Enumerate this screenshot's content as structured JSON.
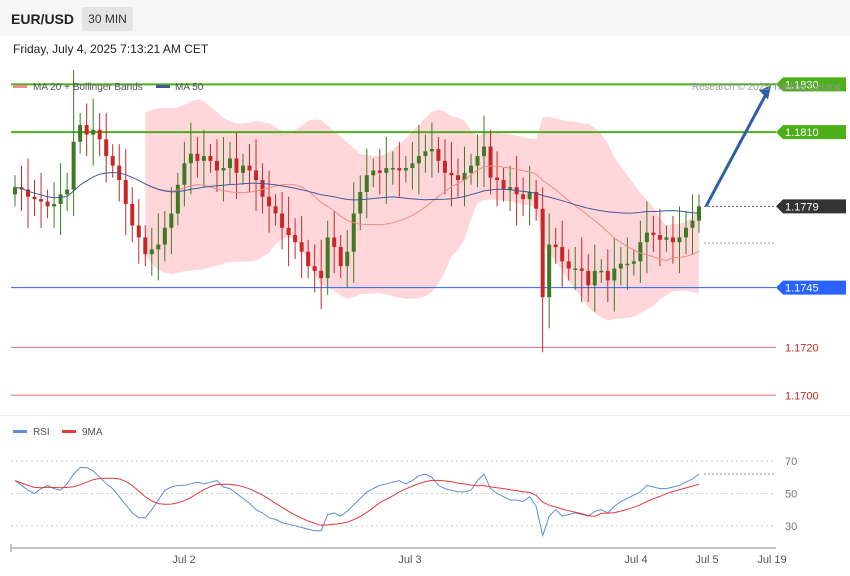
{
  "header": {
    "symbol": "EUR/USD",
    "timeframe": "30 MIN",
    "timestamp": "Friday, July 4, 2025 7:13:21 AM CET"
  },
  "price_panel": {
    "legend": [
      {
        "label": "MA 20 + Bollinger Bands",
        "color": "#f28b82"
      },
      {
        "label": "MA 50",
        "color": "#3c5a9a"
      }
    ],
    "credit": "Research © 2025 Trading Central"
  },
  "rsi_panel": {
    "legend": [
      {
        "label": "RSI",
        "color": "#5b8dd9"
      },
      {
        "label": "9MA",
        "color": "#e53935"
      }
    ]
  },
  "colors": {
    "up": "#3d7a23",
    "down": "#c62828",
    "resistance": "#4caf1a",
    "support": "#2962ff",
    "target": "#e57373",
    "arrow": "#2e5ea8",
    "band": "#ffcdd2"
  },
  "chart_data": [
    {
      "type": "candlestick",
      "title": "EUR/USD",
      "ylim": [
        1.1693,
        1.1836
      ],
      "x_ticks": [
        "Jul 2",
        "Jul 3",
        "Jul 4",
        "Jul 5",
        "Jul 19"
      ],
      "levels": [
        {
          "label": "1.1830",
          "value": 1.183,
          "kind": "resistance"
        },
        {
          "label": "1.1810",
          "value": 1.181,
          "kind": "resistance"
        },
        {
          "label": "1.1779",
          "value": 1.1779,
          "kind": "last"
        },
        {
          "label": "1.1745",
          "value": 1.1745,
          "kind": "support"
        },
        {
          "label": "1.1720",
          "value": 1.172,
          "kind": "support2"
        },
        {
          "label": "1.1700",
          "value": 1.17,
          "kind": "support2"
        }
      ],
      "projection": {
        "from": 1.1779,
        "to": 1.183
      },
      "closes": [
        1.1787,
        1.1786,
        1.1783,
        1.1782,
        1.1781,
        1.1779,
        1.178,
        1.1784,
        1.1786,
        1.1806,
        1.1813,
        1.1809,
        1.1811,
        1.1807,
        1.18,
        1.1796,
        1.179,
        1.178,
        1.1771,
        1.1766,
        1.1759,
        1.1761,
        1.1763,
        1.177,
        1.1776,
        1.1788,
        1.1797,
        1.1801,
        1.1798,
        1.18,
        1.1798,
        1.1794,
        1.1795,
        1.1799,
        1.1793,
        1.1796,
        1.1794,
        1.179,
        1.1783,
        1.1779,
        1.1776,
        1.177,
        1.1767,
        1.1764,
        1.176,
        1.1754,
        1.1752,
        1.1749,
        1.1766,
        1.1762,
        1.1754,
        1.176,
        1.1776,
        1.1785,
        1.1792,
        1.1794,
        1.1793,
        1.1795,
        1.1795,
        1.1794,
        1.1795,
        1.1797,
        1.18,
        1.1802,
        1.1803,
        1.1798,
        1.1793,
        1.1792,
        1.179,
        1.1793,
        1.1796,
        1.18,
        1.1804,
        1.1791,
        1.179,
        1.1786,
        1.1787,
        1.1784,
        1.1782,
        1.1785,
        1.1778,
        1.1741,
        1.1763,
        1.1762,
        1.1756,
        1.1753,
        1.1753,
        1.1752,
        1.1746,
        1.1752,
        1.1752,
        1.1748,
        1.1753,
        1.1755,
        1.1755,
        1.1756,
        1.1764,
        1.1768,
        1.1767,
        1.1765,
        1.1766,
        1.1764,
        1.1766,
        1.177,
        1.1773,
        1.1779
      ],
      "rsi_ylim": [
        20,
        80
      ],
      "rsi_ticks": [
        70,
        50,
        30
      ],
      "rsi": [
        58,
        55,
        52,
        50,
        53,
        55,
        53,
        52,
        56,
        62,
        66,
        66,
        64,
        60,
        56,
        53,
        48,
        43,
        38,
        35,
        35,
        40,
        46,
        52,
        54,
        55,
        55,
        56,
        57,
        56,
        57,
        58,
        54,
        53,
        50,
        47,
        44,
        40,
        38,
        35,
        34,
        32,
        31,
        30,
        29,
        28,
        27,
        27,
        37,
        38,
        36,
        39,
        43,
        47,
        51,
        53,
        55,
        56,
        57,
        58,
        56,
        58,
        61,
        62,
        60,
        55,
        53,
        52,
        51,
        51,
        52,
        58,
        62,
        53,
        50,
        48,
        46,
        46,
        45,
        48,
        42,
        24,
        36,
        40,
        36,
        37,
        38,
        37,
        36,
        39,
        40,
        38,
        42,
        45,
        47,
        49,
        51,
        55,
        54,
        53,
        53,
        54,
        55,
        57,
        59,
        62
      ]
    }
  ]
}
